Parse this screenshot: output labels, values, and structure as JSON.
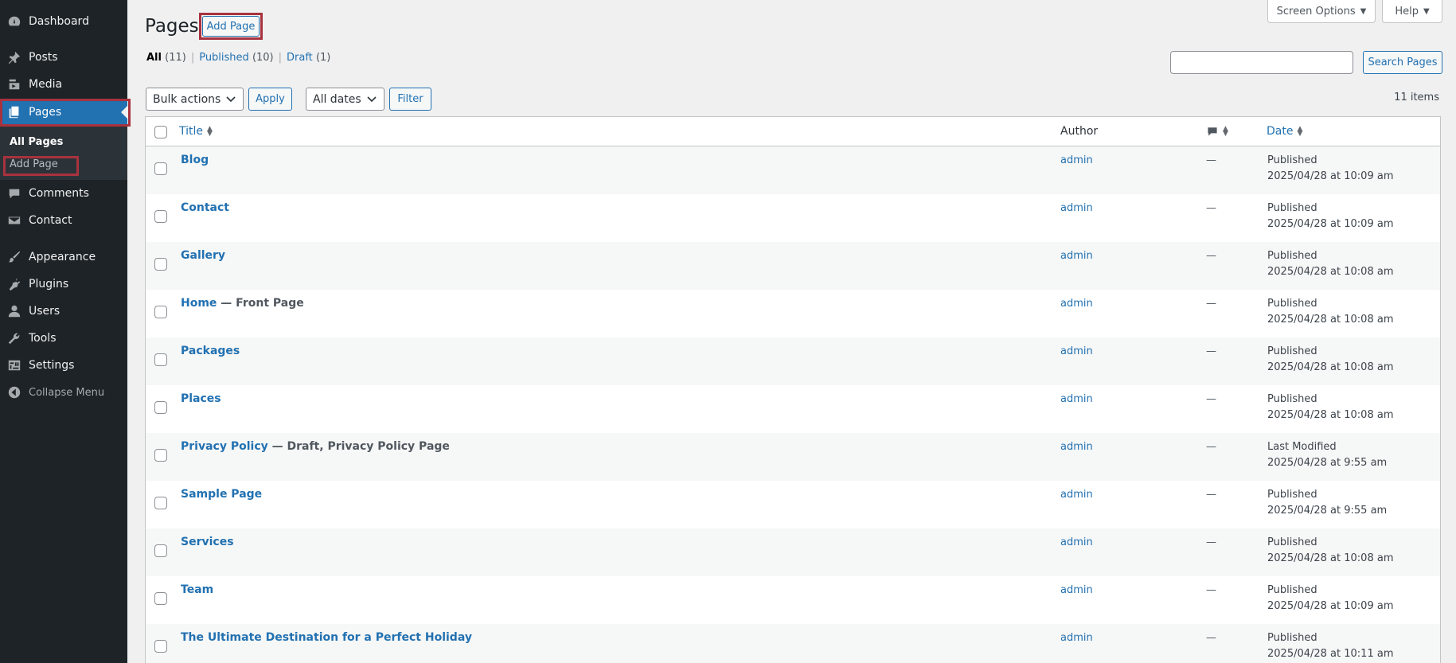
{
  "sidebar": {
    "items": [
      {
        "label": "Dashboard",
        "icon": "dashboard-icon"
      },
      {
        "label": "Posts",
        "icon": "pin-icon"
      },
      {
        "label": "Media",
        "icon": "media-icon"
      },
      {
        "label": "Pages",
        "icon": "pages-icon"
      },
      {
        "label": "Comments",
        "icon": "comment-icon"
      },
      {
        "label": "Contact",
        "icon": "mail-icon"
      },
      {
        "label": "Appearance",
        "icon": "brush-icon"
      },
      {
        "label": "Plugins",
        "icon": "plugin-icon"
      },
      {
        "label": "Users",
        "icon": "user-icon"
      },
      {
        "label": "Tools",
        "icon": "wrench-icon"
      },
      {
        "label": "Settings",
        "icon": "settings-icon"
      }
    ],
    "submenu": [
      "All Pages",
      "Add Page"
    ],
    "collapse_label": "Collapse Menu"
  },
  "header": {
    "title": "Pages",
    "add_button": "Add Page",
    "screen_options": "Screen Options",
    "help": "Help"
  },
  "views": {
    "all_label": "All",
    "all_count": "(11)",
    "published_label": "Published",
    "published_count": "(10)",
    "draft_label": "Draft",
    "draft_count": "(1)",
    "separator": "|"
  },
  "search": {
    "button": "Search Pages",
    "value": ""
  },
  "toolbar": {
    "bulk_actions": "Bulk actions",
    "apply": "Apply",
    "dates": "All dates",
    "filter": "Filter",
    "items_count": "11 items"
  },
  "table": {
    "columns": {
      "title": "Title",
      "author": "Author",
      "date": "Date"
    },
    "rows": [
      {
        "title": "Blog",
        "state": "",
        "author": "admin",
        "comments": "—",
        "status": "Published",
        "date": "2025/04/28 at 10:09 am"
      },
      {
        "title": "Contact",
        "state": "",
        "author": "admin",
        "comments": "—",
        "status": "Published",
        "date": "2025/04/28 at 10:09 am"
      },
      {
        "title": "Gallery",
        "state": "",
        "author": "admin",
        "comments": "—",
        "status": "Published",
        "date": "2025/04/28 at 10:08 am"
      },
      {
        "title": "Home",
        "state": " — Front Page",
        "author": "admin",
        "comments": "—",
        "status": "Published",
        "date": "2025/04/28 at 10:08 am"
      },
      {
        "title": "Packages",
        "state": "",
        "author": "admin",
        "comments": "—",
        "status": "Published",
        "date": "2025/04/28 at 10:08 am"
      },
      {
        "title": "Places",
        "state": "",
        "author": "admin",
        "comments": "—",
        "status": "Published",
        "date": "2025/04/28 at 10:08 am"
      },
      {
        "title": "Privacy Policy",
        "state": " — Draft, Privacy Policy Page",
        "author": "admin",
        "comments": "—",
        "status": "Last Modified",
        "date": "2025/04/28 at 9:55 am"
      },
      {
        "title": "Sample Page",
        "state": "",
        "author": "admin",
        "comments": "—",
        "status": "Published",
        "date": "2025/04/28 at 9:55 am"
      },
      {
        "title": "Services",
        "state": "",
        "author": "admin",
        "comments": "—",
        "status": "Published",
        "date": "2025/04/28 at 10:08 am"
      },
      {
        "title": "Team",
        "state": "",
        "author": "admin",
        "comments": "—",
        "status": "Published",
        "date": "2025/04/28 at 10:09 am"
      },
      {
        "title": "The Ultimate Destination for a Perfect Holiday",
        "state": "",
        "author": "admin",
        "comments": "—",
        "status": "Published",
        "date": "2025/04/28 at 10:11 am"
      }
    ]
  }
}
